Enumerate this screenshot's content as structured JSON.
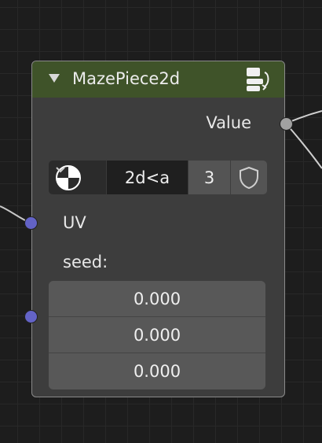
{
  "node": {
    "title": "MazePiece2d",
    "output_label": "Value",
    "expression": "2d<a",
    "count": "3",
    "inputs": {
      "uv_label": "UV",
      "seed_label": "seed:",
      "seed_values": [
        "0.000",
        "0.000",
        "0.000"
      ]
    }
  },
  "colors": {
    "header": "#3f5329",
    "node_body": "#3d3d3d",
    "vector_socket": "#6363c7",
    "value_socket": "#a1a1a1",
    "background": "#1d1d1d"
  },
  "icons": {
    "collapse": "triangle-down-icon",
    "node_icon": "node-tree-icon",
    "shading": "viewport-shading-icon",
    "dropdown": "chevron-down-icon",
    "shield": "shield-icon"
  }
}
